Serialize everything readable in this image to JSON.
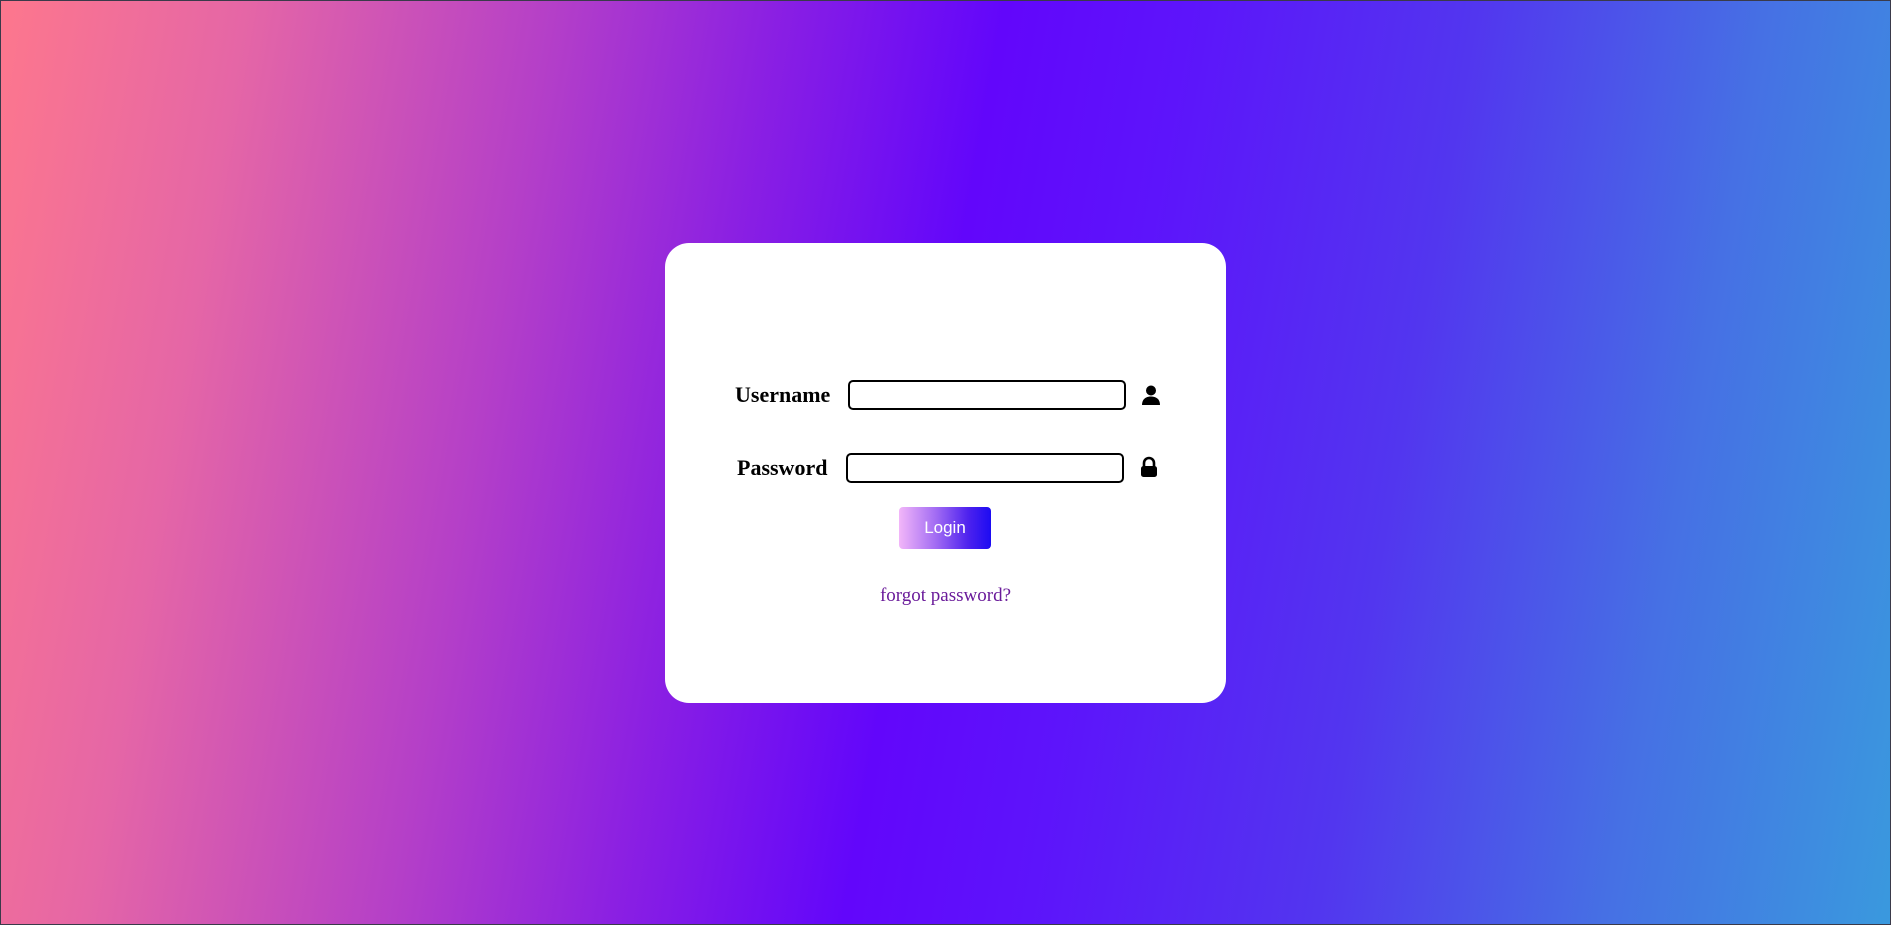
{
  "login_form": {
    "username": {
      "label": "Username",
      "value": "",
      "icon": "user-icon"
    },
    "password": {
      "label": "Password",
      "value": "",
      "icon": "lock-icon"
    },
    "login_button_label": "Login",
    "forgot_password_link": "forgot password?"
  },
  "colors": {
    "background_gradient": [
      "#fd778d",
      "#6206fb",
      "#5236ef",
      "#3a99de"
    ],
    "card_background": "#ffffff",
    "button_gradient": [
      "#f2b6f9",
      "#1c0bf2"
    ],
    "link_color": "#6a1b9a"
  }
}
